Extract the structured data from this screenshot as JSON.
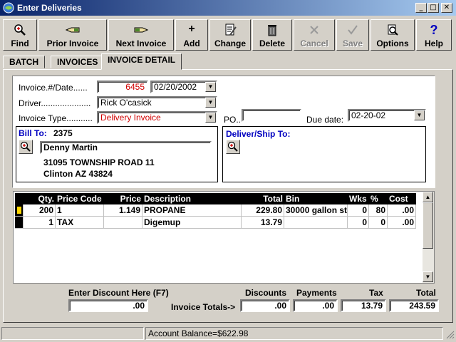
{
  "window": {
    "title": "Enter Deliveries"
  },
  "toolbar": {
    "find": "Find",
    "prior_invoice": "Prior Invoice",
    "next_invoice": "Next Invoice",
    "add": "Add",
    "change": "Change",
    "delete": "Delete",
    "cancel": "Cancel",
    "save": "Save",
    "options": "Options",
    "help": "Help"
  },
  "tabs": [
    "BATCH",
    "INVOICES",
    "INVOICE DETAIL"
  ],
  "form": {
    "invoice_label": "Invoice.#/Date......",
    "invoice_number": "6455",
    "invoice_date": "02/20/2002",
    "driver_label": "Driver.....................",
    "driver_value": "Rick O'casick",
    "invoice_type_label": "Invoice Type...........",
    "invoice_type_value": "Delivery Invoice",
    "po_label": "PO..",
    "po_value": "",
    "due_date_label": "Due date:",
    "due_date_value": "02-20-02"
  },
  "bill_to": {
    "label": "Bill To:",
    "account": "2375",
    "name": "Denny Martin",
    "address1": "31095 TOWNSHIP ROAD 11",
    "address2": "Clinton AZ 43824"
  },
  "ship_to": {
    "label": "Deliver/Ship To:"
  },
  "grid": {
    "columns": [
      "Qty.",
      "Price Code",
      "Price",
      "Description",
      "Total",
      "Bin",
      "Wks",
      "%",
      "Cost"
    ],
    "rows": [
      {
        "qty": "200",
        "price_code": "1",
        "price": "1.149",
        "description": "PROPANE",
        "total": "229.80",
        "bin": "30000 gallon st",
        "wks": "0",
        "pct": "80",
        "cost": ".00"
      },
      {
        "qty": "1",
        "price_code": "TAX",
        "price": "",
        "description": "Digemup",
        "total": "13.79",
        "bin": "",
        "wks": "0",
        "pct": "0",
        "cost": ".00"
      }
    ]
  },
  "totals": {
    "discount_label": "Enter Discount Here (F7)",
    "discount_value": ".00",
    "invoice_totals_label": "Invoice Totals->",
    "discounts_label": "Discounts",
    "discounts_value": ".00",
    "payments_label": "Payments",
    "payments_value": ".00",
    "tax_label": "Tax",
    "tax_value": "13.79",
    "total_label": "Total",
    "total_value": "243.59"
  },
  "status": {
    "account_balance": "Account Balance=$622.98"
  },
  "colors": {
    "title_start": "#0a246a",
    "title_end": "#a6caf0",
    "invoice_red": "#d00000",
    "link_blue": "#0000c0",
    "face": "#d4d0c8"
  }
}
